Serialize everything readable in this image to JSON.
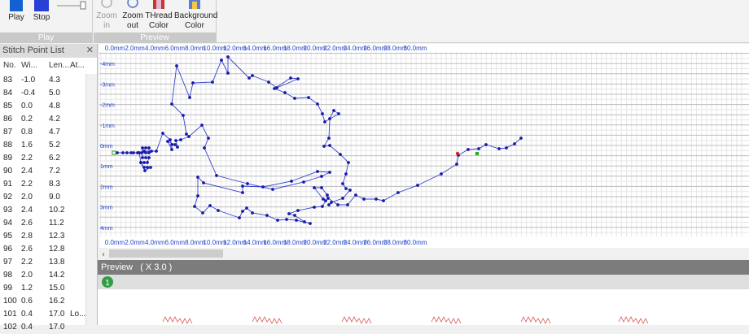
{
  "ribbon": {
    "groups": [
      {
        "label": "Play"
      },
      {
        "label": "Preview"
      }
    ],
    "play": {
      "label": "Play"
    },
    "stop": {
      "label": "Stop"
    },
    "zoom_in": {
      "label_line1": "Zoom",
      "label_line2": "in"
    },
    "zoom_out": {
      "label_line1": "Zoom",
      "label_line2": "out"
    },
    "thread_color": {
      "label_line1": "THread",
      "label_line2": "Color"
    },
    "background_color": {
      "label_line1": "Background",
      "label_line2": "Color"
    }
  },
  "sidebar": {
    "title": "Stitch Point List",
    "close_label": "✕",
    "columns": [
      "No.",
      "Wi...",
      "Len...",
      "At..."
    ],
    "rows": [
      [
        "83",
        "-1.0",
        "4.3",
        ""
      ],
      [
        "84",
        "-0.4",
        "5.0",
        ""
      ],
      [
        "85",
        "0.0",
        "4.8",
        ""
      ],
      [
        "86",
        "0.2",
        "4.2",
        ""
      ],
      [
        "87",
        "0.8",
        "4.7",
        ""
      ],
      [
        "88",
        "1.6",
        "5.2",
        ""
      ],
      [
        "89",
        "2.2",
        "6.2",
        ""
      ],
      [
        "90",
        "2.4",
        "7.2",
        ""
      ],
      [
        "91",
        "2.2",
        "8.3",
        ""
      ],
      [
        "92",
        "2.0",
        "9.0",
        ""
      ],
      [
        "93",
        "2.4",
        "10.2",
        ""
      ],
      [
        "94",
        "2.6",
        "11.2",
        ""
      ],
      [
        "95",
        "2.8",
        "12.3",
        ""
      ],
      [
        "96",
        "2.6",
        "12.8",
        ""
      ],
      [
        "97",
        "2.2",
        "13.8",
        ""
      ],
      [
        "98",
        "2.0",
        "14.2",
        ""
      ],
      [
        "99",
        "1.2",
        "15.0",
        ""
      ],
      [
        "100",
        "0.6",
        "16.2",
        ""
      ],
      [
        "101",
        "0.4",
        "17.0",
        "Lo..."
      ],
      [
        "102",
        "0.4",
        "17.0",
        ""
      ]
    ]
  },
  "rulers": {
    "x_labels": [
      "0.0mm",
      "2.0mm",
      "4.0mm",
      "6.0mm",
      "8.0mm",
      "10.0mm",
      "12.0mm",
      "14.0mm",
      "16.0mm",
      "18.0mm",
      "20.0mm",
      "22.0mm",
      "24.0mm",
      "26.0mm",
      "28.0mm",
      "30.0mm"
    ],
    "y_labels": [
      "-4mm",
      "-3mm",
      "-2mm",
      "-1mm",
      "0mm",
      "1mm",
      "2mm",
      "3mm",
      "4mm"
    ]
  },
  "preview": {
    "title": "Preview",
    "scale": "( X 3.0 )",
    "badge": "1"
  },
  "colors": {
    "stitch_line": "#3344cc",
    "stitch_point": "#1a1aaa",
    "grid_minor": "#e6e6e6",
    "grid_major": "#bdbdbd",
    "ruler_text": "#2244cc",
    "preview_stitch": "#d9534f"
  },
  "icons": {
    "play": "play-icon",
    "stop": "stop-icon",
    "slider": "speed-slider",
    "zoom_in": "magnifier-plus-icon",
    "zoom_out": "magnifier-minus-icon",
    "thread_color": "color-palette-icon",
    "background_color": "background-color-icon"
  }
}
